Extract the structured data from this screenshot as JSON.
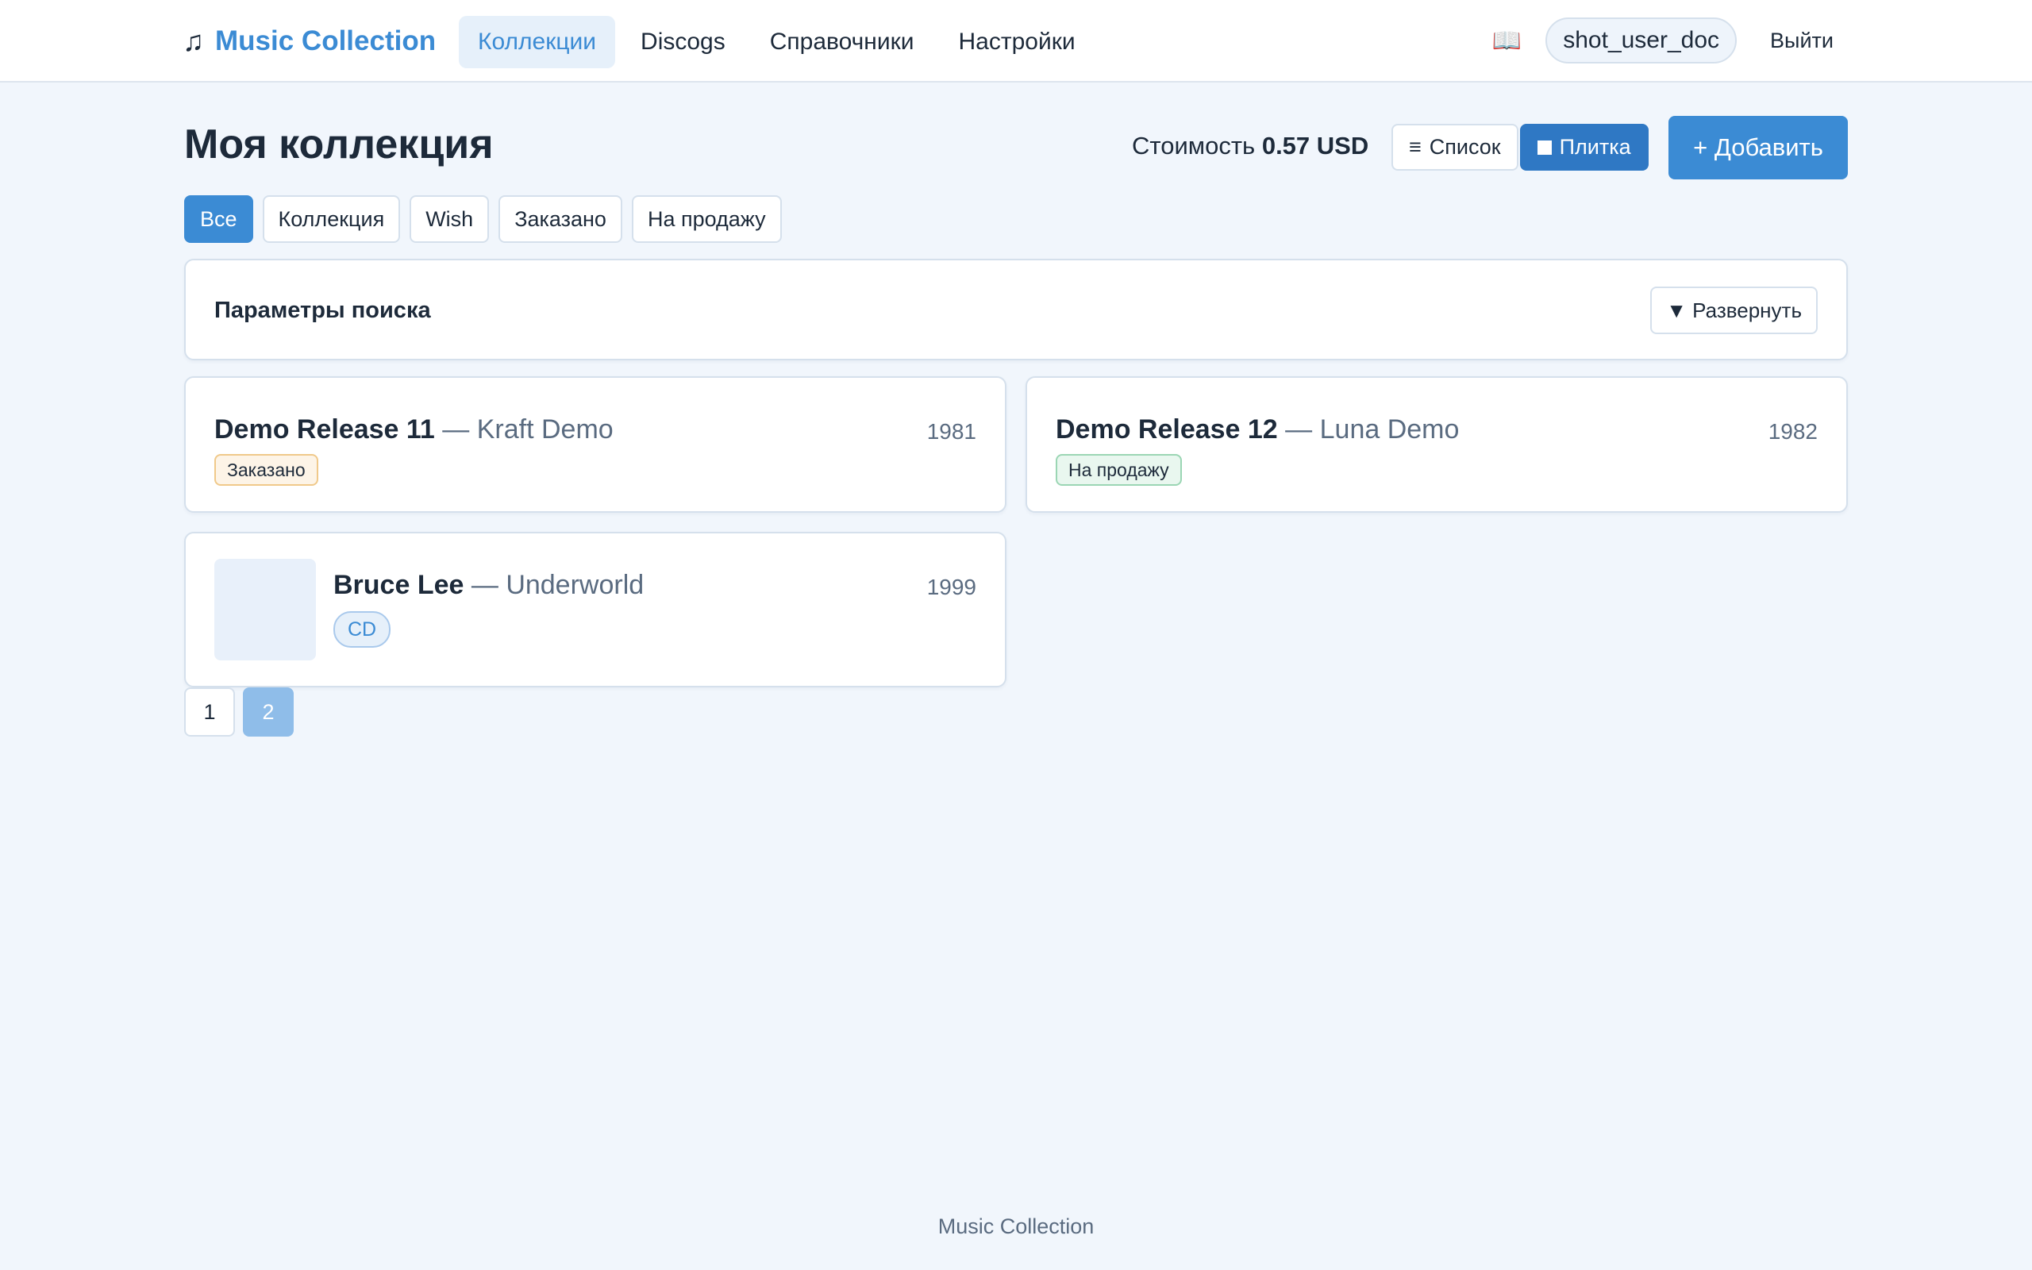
{
  "header": {
    "brand": "Music Collection",
    "brand_icon": "music-note-icon",
    "nav": [
      {
        "label": "Коллекции",
        "active": true
      },
      {
        "label": "Discogs",
        "active": false
      },
      {
        "label": "Справочники",
        "active": false
      },
      {
        "label": "Настройки",
        "active": false
      }
    ],
    "help_icon": "book-icon",
    "user": "shot_user_doc",
    "logout": "Выйти"
  },
  "page": {
    "title": "Моя коллекция",
    "cost_label": "Стоимость",
    "cost_value": "0.57 USD",
    "view_list": "Список",
    "view_tiles": "Плитка",
    "active_view": "Плитка",
    "add_button": "+ Добавить"
  },
  "filters": [
    {
      "label": "Все",
      "active": true
    },
    {
      "label": "Коллекция",
      "active": false
    },
    {
      "label": "Wish",
      "active": false
    },
    {
      "label": "Заказано",
      "active": false
    },
    {
      "label": "На продажу",
      "active": false
    }
  ],
  "search": {
    "title": "Параметры поиска",
    "expand": "Развернуть"
  },
  "cards": [
    {
      "title": "Demo Release 11",
      "separator": " — ",
      "artist": "Kraft Demo",
      "year": "1981",
      "badge": "Заказано",
      "badge_type": "ordered",
      "has_cover": false
    },
    {
      "title": "Demo Release 12",
      "separator": " — ",
      "artist": "Luna Demo",
      "year": "1982",
      "badge": "На продажу",
      "badge_type": "sale",
      "has_cover": false
    },
    {
      "title": "Bruce Lee",
      "separator": " — ",
      "artist": "Underworld",
      "year": "1999",
      "badge": "CD",
      "badge_type": "format",
      "has_cover": true
    }
  ],
  "pagination": {
    "pages": [
      "1",
      "2"
    ],
    "current": "2"
  },
  "footer": "Music Collection",
  "colors": {
    "accent": "#3b8bd4",
    "background": "#f1f6fc",
    "active_view": "#2f78c4"
  }
}
